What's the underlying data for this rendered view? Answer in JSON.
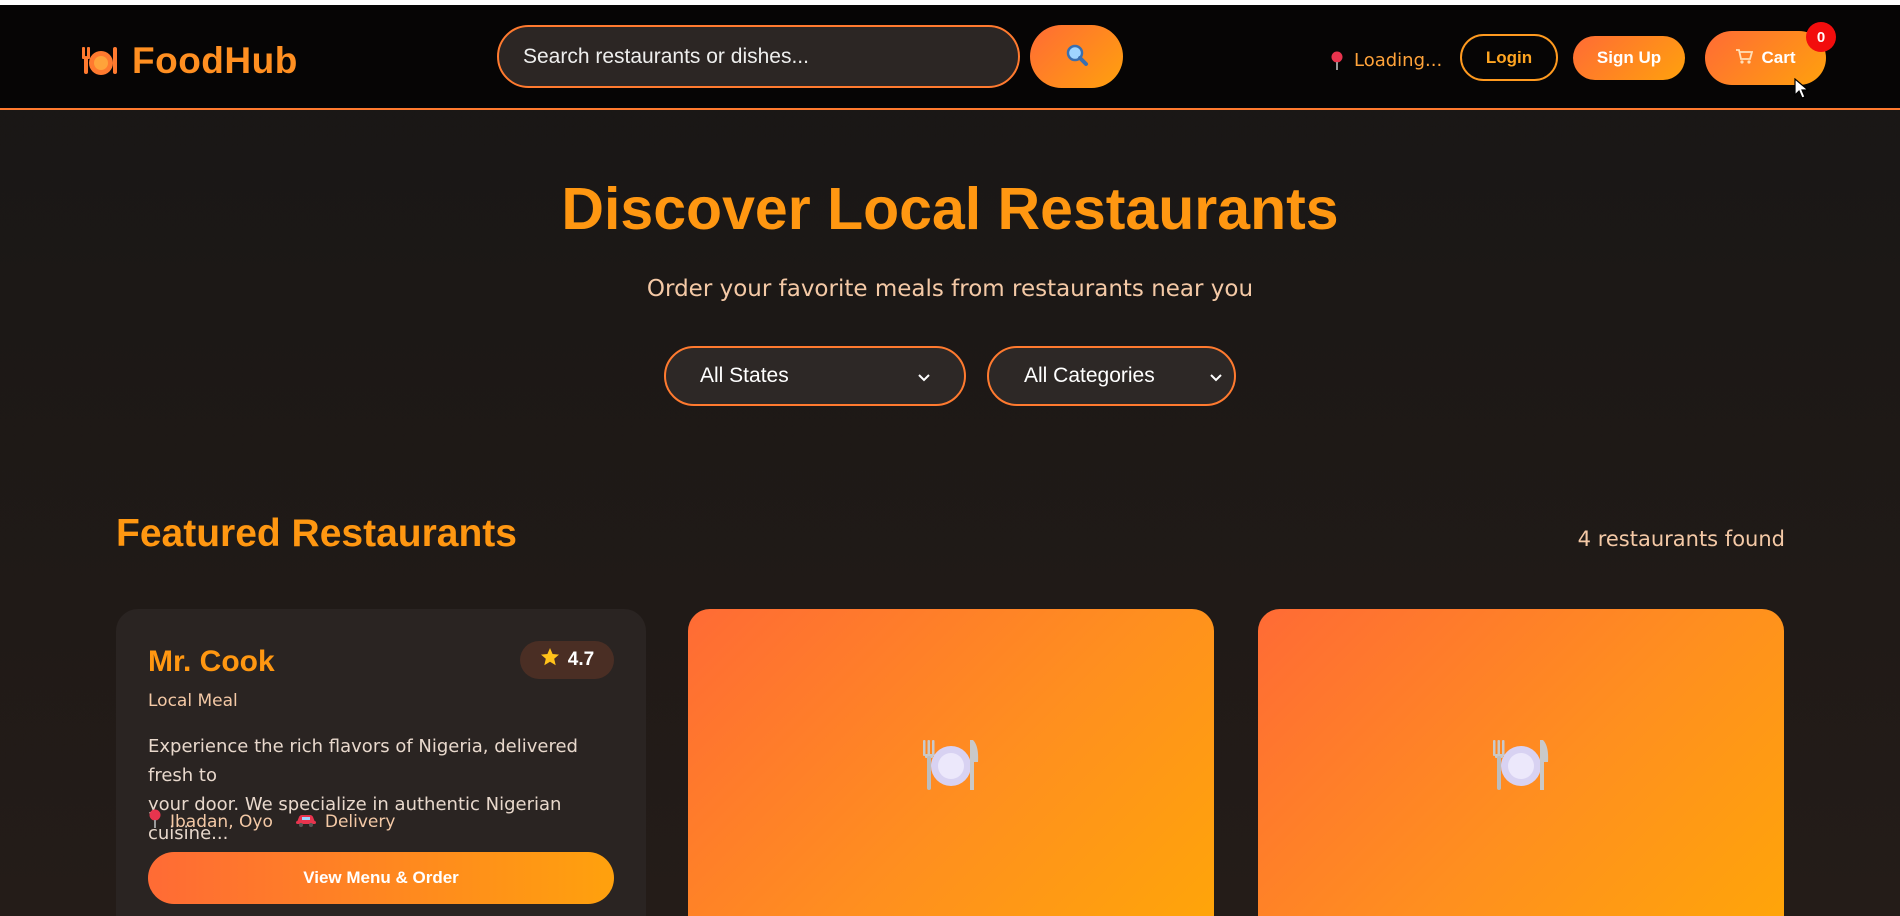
{
  "header": {
    "logo_text": "FoodHub",
    "search_placeholder": "Search restaurants or dishes...",
    "location_text": "Loading...",
    "login_label": "Login",
    "signup_label": "Sign Up",
    "cart_label": "Cart",
    "cart_count": "0"
  },
  "hero": {
    "title": "Discover Local Restaurants",
    "subtitle": "Order your favorite meals from restaurants near you",
    "state_filter": "All States",
    "category_filter": "All Categories"
  },
  "featured": {
    "title": "Featured Restaurants",
    "count_text": "4 restaurants found",
    "restaurants": [
      {
        "name": "Mr. Cook",
        "rating": "4.7",
        "category": "Local Meal",
        "description_line1": "Experience the rich flavors of Nigeria, delivered fresh to",
        "description_line2": "your door. We specialize in authentic Nigerian cuisine...",
        "location": "Ibadan, Oyo",
        "delivery": "Delivery",
        "button_label": "View Menu & Order"
      },
      {
        "image_icon": "plate-cutlery-icon"
      },
      {
        "image_icon": "plate-cutlery-icon"
      }
    ]
  },
  "colors": {
    "accent_orange": "#ff9711",
    "gradient_start": "#ff6b35",
    "gradient_end": "#ffa10d",
    "badge_red": "#f20d0d",
    "background": "#1c1816"
  }
}
